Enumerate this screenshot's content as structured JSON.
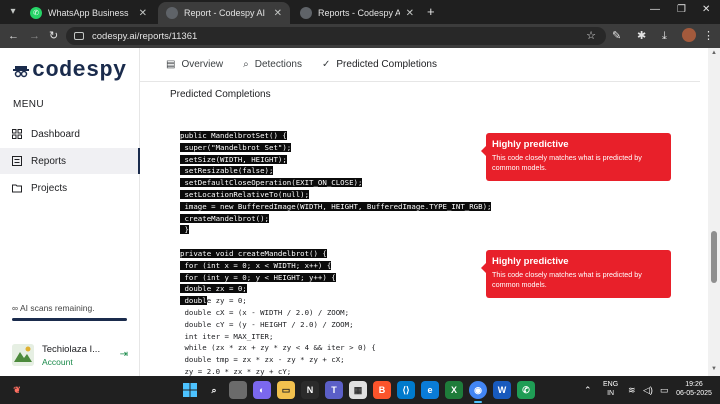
{
  "browser": {
    "tabs": [
      {
        "title": "WhatsApp Business",
        "active": false,
        "favicon_color": "#25d366"
      },
      {
        "title": "Report - Codespy AI Detector I...",
        "active": true,
        "favicon_color": "#5f6368"
      },
      {
        "title": "Reports - Codespy AI Detector",
        "active": false,
        "favicon_color": "#5f6368"
      }
    ],
    "url": "codespy.ai/reports/11361"
  },
  "sidebar": {
    "logo_text": "codespy",
    "menu_label": "MENU",
    "items": [
      {
        "label": "Dashboard",
        "icon": "grid-icon",
        "active": false
      },
      {
        "label": "Reports",
        "icon": "list-icon",
        "active": true
      },
      {
        "label": "Projects",
        "icon": "folder-icon",
        "active": false
      }
    ],
    "scans_text": "∞ AI scans remaining.",
    "account_name": "Techiolaza I...",
    "account_sub": "Account"
  },
  "main": {
    "tabs": [
      {
        "label": "Overview",
        "icon": "document-icon"
      },
      {
        "label": "Detections",
        "icon": "search-icon"
      },
      {
        "label": "Predicted Completions",
        "icon": "check-icon"
      }
    ],
    "section_title": "Predicted Completions",
    "badges": [
      {
        "title": "Highly predictive",
        "text": "This code closely matches what is predicted by common models."
      },
      {
        "title": "Highly predictive",
        "text": "This code closely matches what is predicted by common models."
      }
    ],
    "code_lines": [
      {
        "hl": "public MandelbrotSet() {",
        "rest": ""
      },
      {
        "hl": " super(\"Mandelbrot Set\");",
        "rest": ""
      },
      {
        "hl": " setSize(WIDTH, HEIGHT);",
        "rest": ""
      },
      {
        "hl": " setResizable(false);",
        "rest": ""
      },
      {
        "hl": " setDefaultCloseOperation(EXIT_ON_CLOSE);",
        "rest": ""
      },
      {
        "hl": " setLocationRelativeTo(null);",
        "rest": ""
      },
      {
        "hl": " image = new BufferedImage(WIDTH, HEIGHT, BufferedImage.TYPE_INT_RGB);",
        "rest": ""
      },
      {
        "hl": " createMandelbrot();",
        "rest": ""
      },
      {
        "hl": " }",
        "rest": ""
      },
      {
        "hl": "",
        "rest": ""
      },
      {
        "hl": "private void createMandelbrot() {",
        "rest": ""
      },
      {
        "hl": " for (int x = 0; x < WIDTH; x++) {",
        "rest": ""
      },
      {
        "hl": " for (int y = 0; y < HEIGHT; y++) {",
        "rest": ""
      },
      {
        "hl": " double zx = 0;",
        "rest": ""
      },
      {
        "hl": " doubl",
        "rest": "e zy = 0;"
      },
      {
        "hl": "",
        "rest": " double cX = (x - WIDTH / 2.0) / ZOOM;"
      },
      {
        "hl": "",
        "rest": " double cY = (y - HEIGHT / 2.0) / ZOOM;"
      },
      {
        "hl": "",
        "rest": " int iter = MAX_ITER;"
      },
      {
        "hl": "",
        "rest": " while (zx * zx + zy * zy < 4 && iter > 0) {"
      },
      {
        "hl": "",
        "rest": " double tmp = zx * zx - zy * zy + cX;"
      },
      {
        "hl": "",
        "rest": " zy = 2.0 * zx * zy + cY;"
      }
    ]
  },
  "taskbar": {
    "lang": "ENG",
    "region": "IN",
    "time": "19:26",
    "date": "06-05-2025"
  }
}
